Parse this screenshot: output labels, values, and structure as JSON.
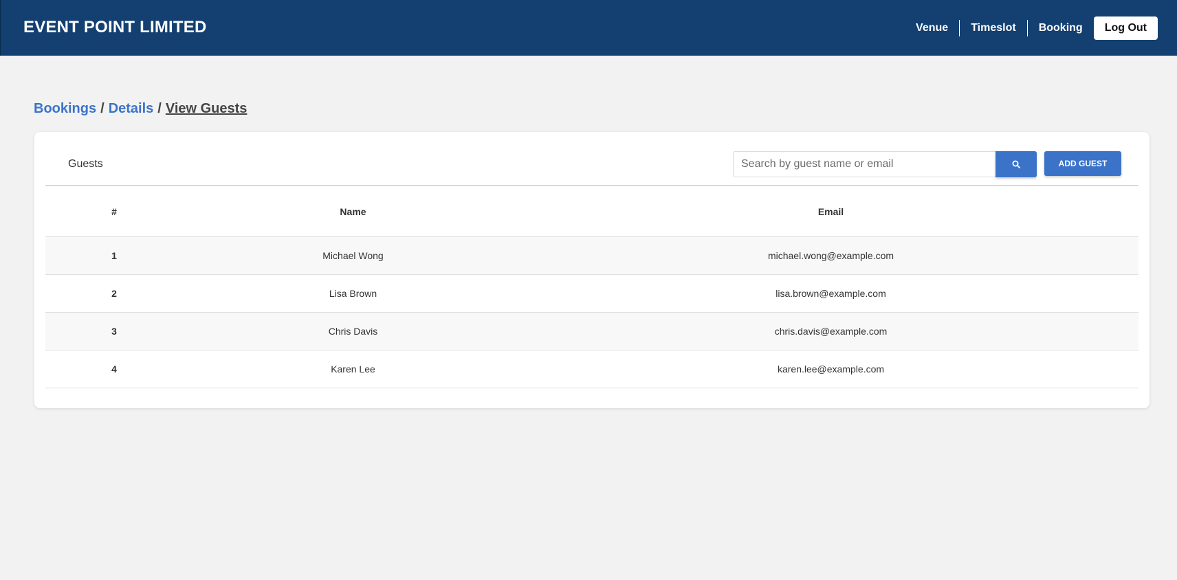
{
  "header": {
    "brand": "EVENT POINT LIMITED",
    "nav": [
      {
        "label": "Venue"
      },
      {
        "label": "Timeslot"
      },
      {
        "label": "Booking"
      }
    ],
    "logout_label": "Log Out"
  },
  "breadcrumb": {
    "items": [
      "Bookings",
      "Details"
    ],
    "current": "View Guests",
    "separator": "/"
  },
  "guests": {
    "title": "Guests",
    "search_placeholder": "Search by guest name or email",
    "search_icon": "search-icon",
    "add_label": "ADD GUEST",
    "columns": [
      "#",
      "Name",
      "Email"
    ],
    "rows": [
      {
        "num": "1",
        "name": "Michael Wong",
        "email": "michael.wong@example.com"
      },
      {
        "num": "2",
        "name": "Lisa Brown",
        "email": "lisa.brown@example.com"
      },
      {
        "num": "3",
        "name": "Chris Davis",
        "email": "chris.davis@example.com"
      },
      {
        "num": "4",
        "name": "Karen Lee",
        "email": "karen.lee@example.com"
      }
    ]
  },
  "colors": {
    "navbar": "#133f71",
    "accent": "#3b73c9",
    "background": "#f2f2f2"
  }
}
